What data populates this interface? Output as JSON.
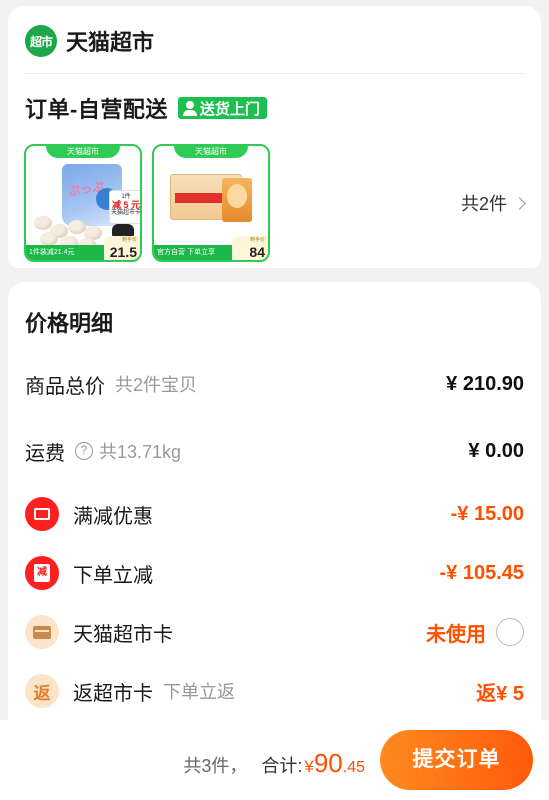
{
  "store": {
    "logo_text": "超市",
    "name": "天猫超市"
  },
  "order": {
    "title": "订单-自营配送",
    "delivery_badge": "送货上门"
  },
  "products": [
    {
      "top_label": "天猫超市",
      "bottom_label": "1件装减21.4元",
      "price_tag_label": "到手价",
      "price": "21.5",
      "coupon_line1": "1件",
      "coupon_amount": "减 5 元",
      "coupon_line2": "天猫超市卡"
    },
    {
      "top_label": "天猫超市",
      "bottom_label": "官方自营  下单立享",
      "price_tag_label": "到手价",
      "price": "84"
    }
  ],
  "product_count": "共2件",
  "price_detail": {
    "title": "价格明细",
    "goods_total": {
      "label": "商品总价",
      "sub": "共2件宝贝",
      "value": "¥ 210.90"
    },
    "shipping": {
      "label": "运费",
      "sub": "共13.71kg",
      "value": "¥ 0.00"
    },
    "full_discount": {
      "label": "满减优惠",
      "value": "-¥ 15.00"
    },
    "order_discount": {
      "label": "下单立减",
      "icon_text": "减",
      "value": "-¥ 105.45"
    },
    "tmall_card": {
      "label": "天猫超市卡",
      "value": "未使用"
    },
    "cashback_card": {
      "label": "返超市卡",
      "icon_text": "返",
      "sub": "下单立返",
      "value": "返¥ 5"
    }
  },
  "bottom_bar": {
    "quantity_text": "共3件，",
    "sum_label": "合计:",
    "currency": "¥",
    "amount_int": "90",
    "amount_dec": ".45",
    "submit_label": "提交订单"
  },
  "colors": {
    "brand_green": "#1aa84a",
    "accent_orange": "#ff5000",
    "badge_red": "#ff1f1f"
  }
}
